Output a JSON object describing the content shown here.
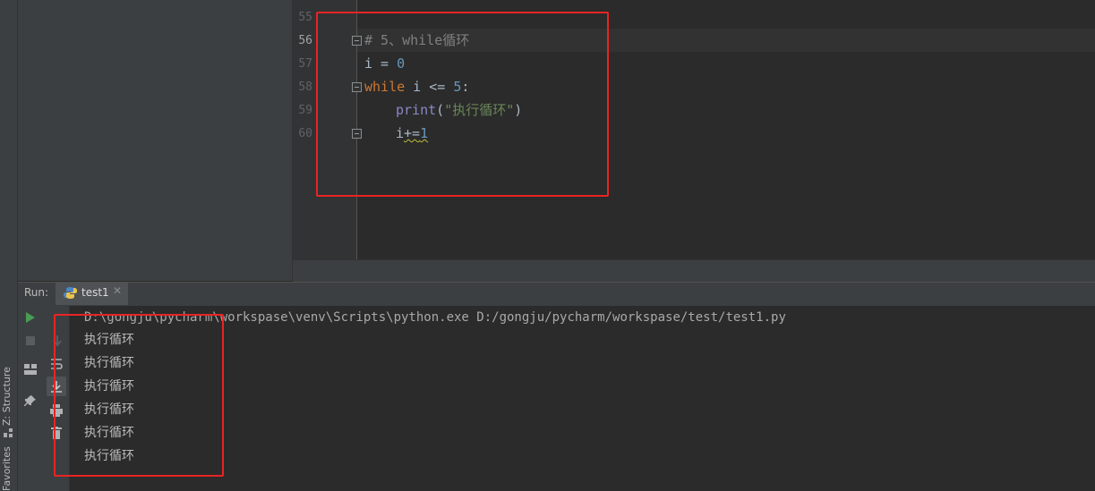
{
  "sidebar": {
    "tool_windows": [
      "Z: Structure",
      "Favorites"
    ]
  },
  "editor": {
    "line_numbers": [
      "55",
      "56",
      "57",
      "58",
      "59",
      "60"
    ],
    "current_line": "56",
    "code": {
      "comment": "# 5、while循环",
      "assign_var": "i = ",
      "assign_val": "0",
      "while_kw": "while",
      "while_cond": " i <= ",
      "while_limit": "5",
      "while_colon": ":",
      "print_fn": "print",
      "print_open": "(",
      "print_str": "\"执行循环\"",
      "print_close": ")",
      "incr_var": "i",
      "incr_op": "+=",
      "incr_val": "1"
    }
  },
  "run_panel": {
    "label": "Run:",
    "tab": "test1",
    "tab_close": "✕",
    "command": "D:\\gongju\\pycharm\\workspase\\venv\\Scripts\\python.exe D:/gongju/pycharm/workspase/test/test1.py",
    "output": [
      "执行循环",
      "执行循环",
      "执行循环",
      "执行循环",
      "执行循环",
      "执行循环"
    ]
  },
  "colors": {
    "highlight_box": "#e82424",
    "editor_bg": "#2b2b2b",
    "keyword": "#cc7832",
    "string": "#6a8759",
    "number": "#6897bb",
    "run_icon": "#499c54"
  }
}
